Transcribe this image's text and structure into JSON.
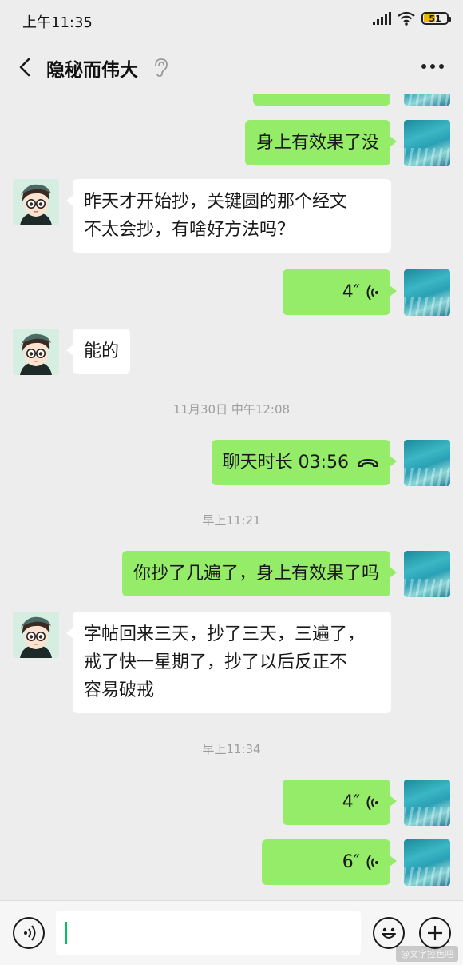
{
  "status_bar": {
    "time": "上午11:35",
    "battery": "51"
  },
  "header": {
    "title": "隐秘而伟大"
  },
  "messages": {
    "m1": {
      "text": "身上有效果了没"
    },
    "m2": {
      "text": "昨天才开始抄，关键圆的那个经文",
      "text2": "不太会抄，有啥好方法吗？"
    },
    "m3": {
      "duration": "4″"
    },
    "m4": {
      "text": "能的"
    },
    "t1": {
      "text": "11月30日 中午12:08"
    },
    "m5": {
      "label": "聊天时长 03:56"
    },
    "t2": {
      "text": "早上11:21"
    },
    "m6": {
      "text": "你抄了几遍了，身上有效果了吗"
    },
    "m7": {
      "line1": "字帖回来三天，抄了三天，三遍了，",
      "line2": "戒了快一星期了，抄了以后反正不",
      "line3": "容易破戒"
    },
    "t3": {
      "text": "早上11:34"
    },
    "m8": {
      "duration": "4″"
    },
    "m9": {
      "duration": "6″"
    }
  },
  "input": {
    "value": ""
  },
  "watermark": {
    "text": "@文字控色吧"
  },
  "colors": {
    "my_bubble": "#95ec69",
    "other_bubble": "#ffffff",
    "background": "#ededed",
    "caret": "#07c160"
  },
  "icons": {
    "back": "chevron-left-icon",
    "ear": "ear-icon",
    "more": "more-dots-icon",
    "voice": "voice-wave-icon",
    "call": "phone-hangup-icon",
    "voice_input": "voice-input-icon",
    "emoji": "emoji-icon",
    "add": "plus-icon"
  }
}
